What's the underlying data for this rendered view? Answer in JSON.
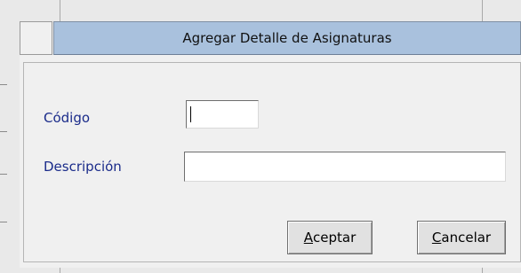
{
  "dialog": {
    "title": "Agregar Detalle de Asignaturas"
  },
  "form": {
    "codigo_label": "Código",
    "codigo_value": "",
    "descripcion_label": "Descripción",
    "descripcion_value": ""
  },
  "buttons": {
    "aceptar": {
      "mnemonic": "A",
      "rest": "ceptar"
    },
    "cancelar": {
      "mnemonic": "C",
      "rest": "ancelar"
    }
  },
  "colors": {
    "title_bar": "#a9c1dd",
    "label_text": "#1a2b8a",
    "panel": "#f0f0f0"
  }
}
